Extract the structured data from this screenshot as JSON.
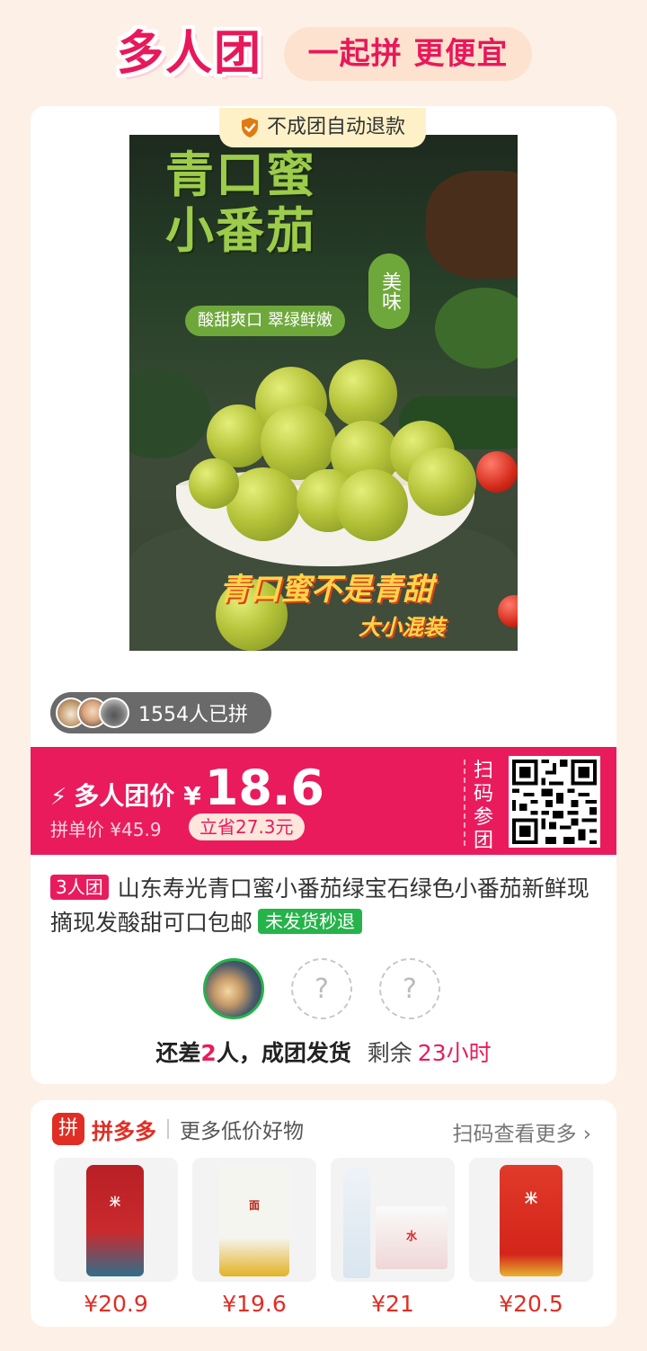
{
  "header": {
    "brand": "多人团",
    "slogan": "一起拼 更便宜"
  },
  "product": {
    "refund_badge": "不成团自动退款",
    "image": {
      "title_line1": "青口蜜",
      "title_line2": "小番茄",
      "tag_vertical": "美味",
      "tagline": "酸甜爽口 翠绿鲜嫩",
      "bottom_text": "青口蜜不是青甜",
      "bottom_sub": "大小混装"
    },
    "joined_text": "1554人已拼",
    "price_label": "多人团价",
    "currency": "¥",
    "price": "18.6",
    "single_price": "拼单价 ¥45.9",
    "save_text": "立省27.3元",
    "scan_label": "扫码参团",
    "group_tag": "3人团",
    "title": "山东寿光青口蜜小番茄绿宝石绿色小番茄新鲜现摘现发酸甜可口包邮",
    "refund_tag": "未发货秒退",
    "slot_placeholder": "?",
    "status_prefix": "还差",
    "status_count": "2",
    "status_suffix": "人，成团发货",
    "remain_label": "剩余",
    "remain_time": "23小时"
  },
  "recommend": {
    "logo_glyph": "拼",
    "brand": "拼多多",
    "subtitle": "更多低价好物",
    "more_link": "扫码查看更多",
    "items": [
      {
        "price": "¥20.9"
      },
      {
        "price": "¥19.6"
      },
      {
        "price": "¥21"
      },
      {
        "price": "¥20.5"
      }
    ]
  },
  "colors": {
    "accent": "#ea1b5d",
    "pdd_red": "#e02e24",
    "success_green": "#25b34a",
    "background": "#fdf1e7"
  }
}
